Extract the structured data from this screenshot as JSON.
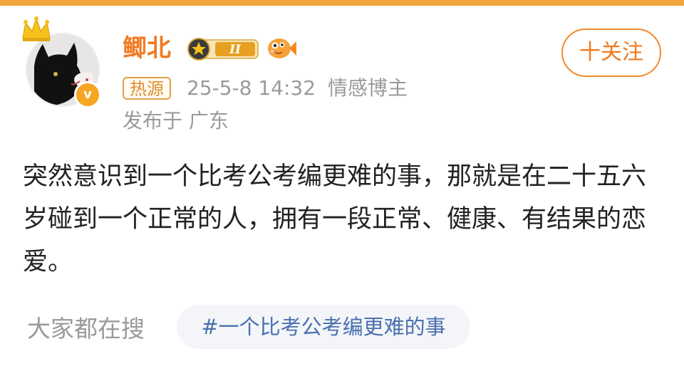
{
  "user": {
    "name": "鲫北",
    "level_numeral": "II",
    "verified_mark": "v"
  },
  "follow_button": {
    "label": "十关注"
  },
  "meta": {
    "source_tag": "热源",
    "timestamp": "25-5-8 14:32",
    "category": "情感博主",
    "location": "发布于 广东"
  },
  "post": {
    "text": "突然意识到一个比考公考编更难的事，那就是在二十五六岁碰到一个正常的人，拥有一段正常、健康、有结果的恋爱。"
  },
  "search": {
    "label": "大家都在搜",
    "topic": "#一个比考公考编更难的事"
  },
  "colors": {
    "accent_orange": "#f27b22",
    "link_blue": "#4a6fb0",
    "meta_gray": "#9a9a9a",
    "header_strip": "#f2a33a"
  },
  "icons": {
    "crown": "crown-icon",
    "verified": "verified-badge-icon",
    "level": "level-badge-icon",
    "fish": "fish-emoji-icon"
  }
}
